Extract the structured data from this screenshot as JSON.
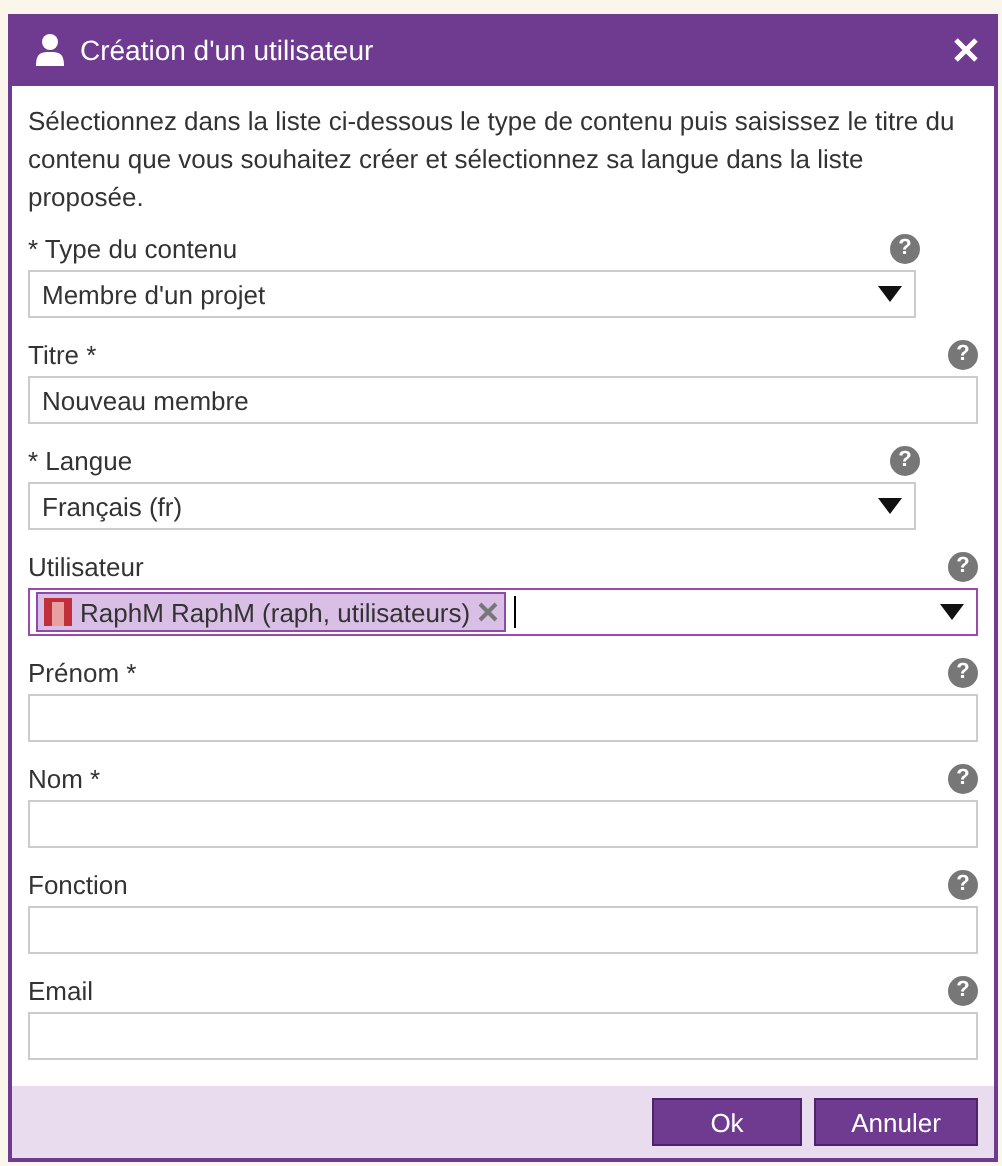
{
  "window": {
    "title": "Création d'un utilisateur"
  },
  "intro": "Sélectionnez dans la liste ci-dessous le type de contenu puis saisissez le titre du contenu que vous souhaitez créer et sélectionnez sa langue dans la liste proposée.",
  "fields": [
    {
      "kind": "select",
      "label": "* Type du contenu",
      "value": "Membre d'un projet"
    },
    {
      "kind": "text",
      "label": "Titre *",
      "value": "Nouveau membre"
    },
    {
      "kind": "select",
      "label": "* Langue",
      "value": "Français (fr)"
    },
    {
      "kind": "tags",
      "label": "Utilisateur",
      "focused": true,
      "tags": [
        "RaphM RaphM (raph, utilisateurs)"
      ]
    },
    {
      "kind": "text",
      "label": "Prénom *"
    },
    {
      "kind": "text",
      "label": "Nom *"
    },
    {
      "kind": "text",
      "label": "Fonction"
    },
    {
      "kind": "text",
      "label": "Email"
    }
  ],
  "help_icon": "?",
  "buttons": [
    "Ok",
    "Annuler"
  ]
}
